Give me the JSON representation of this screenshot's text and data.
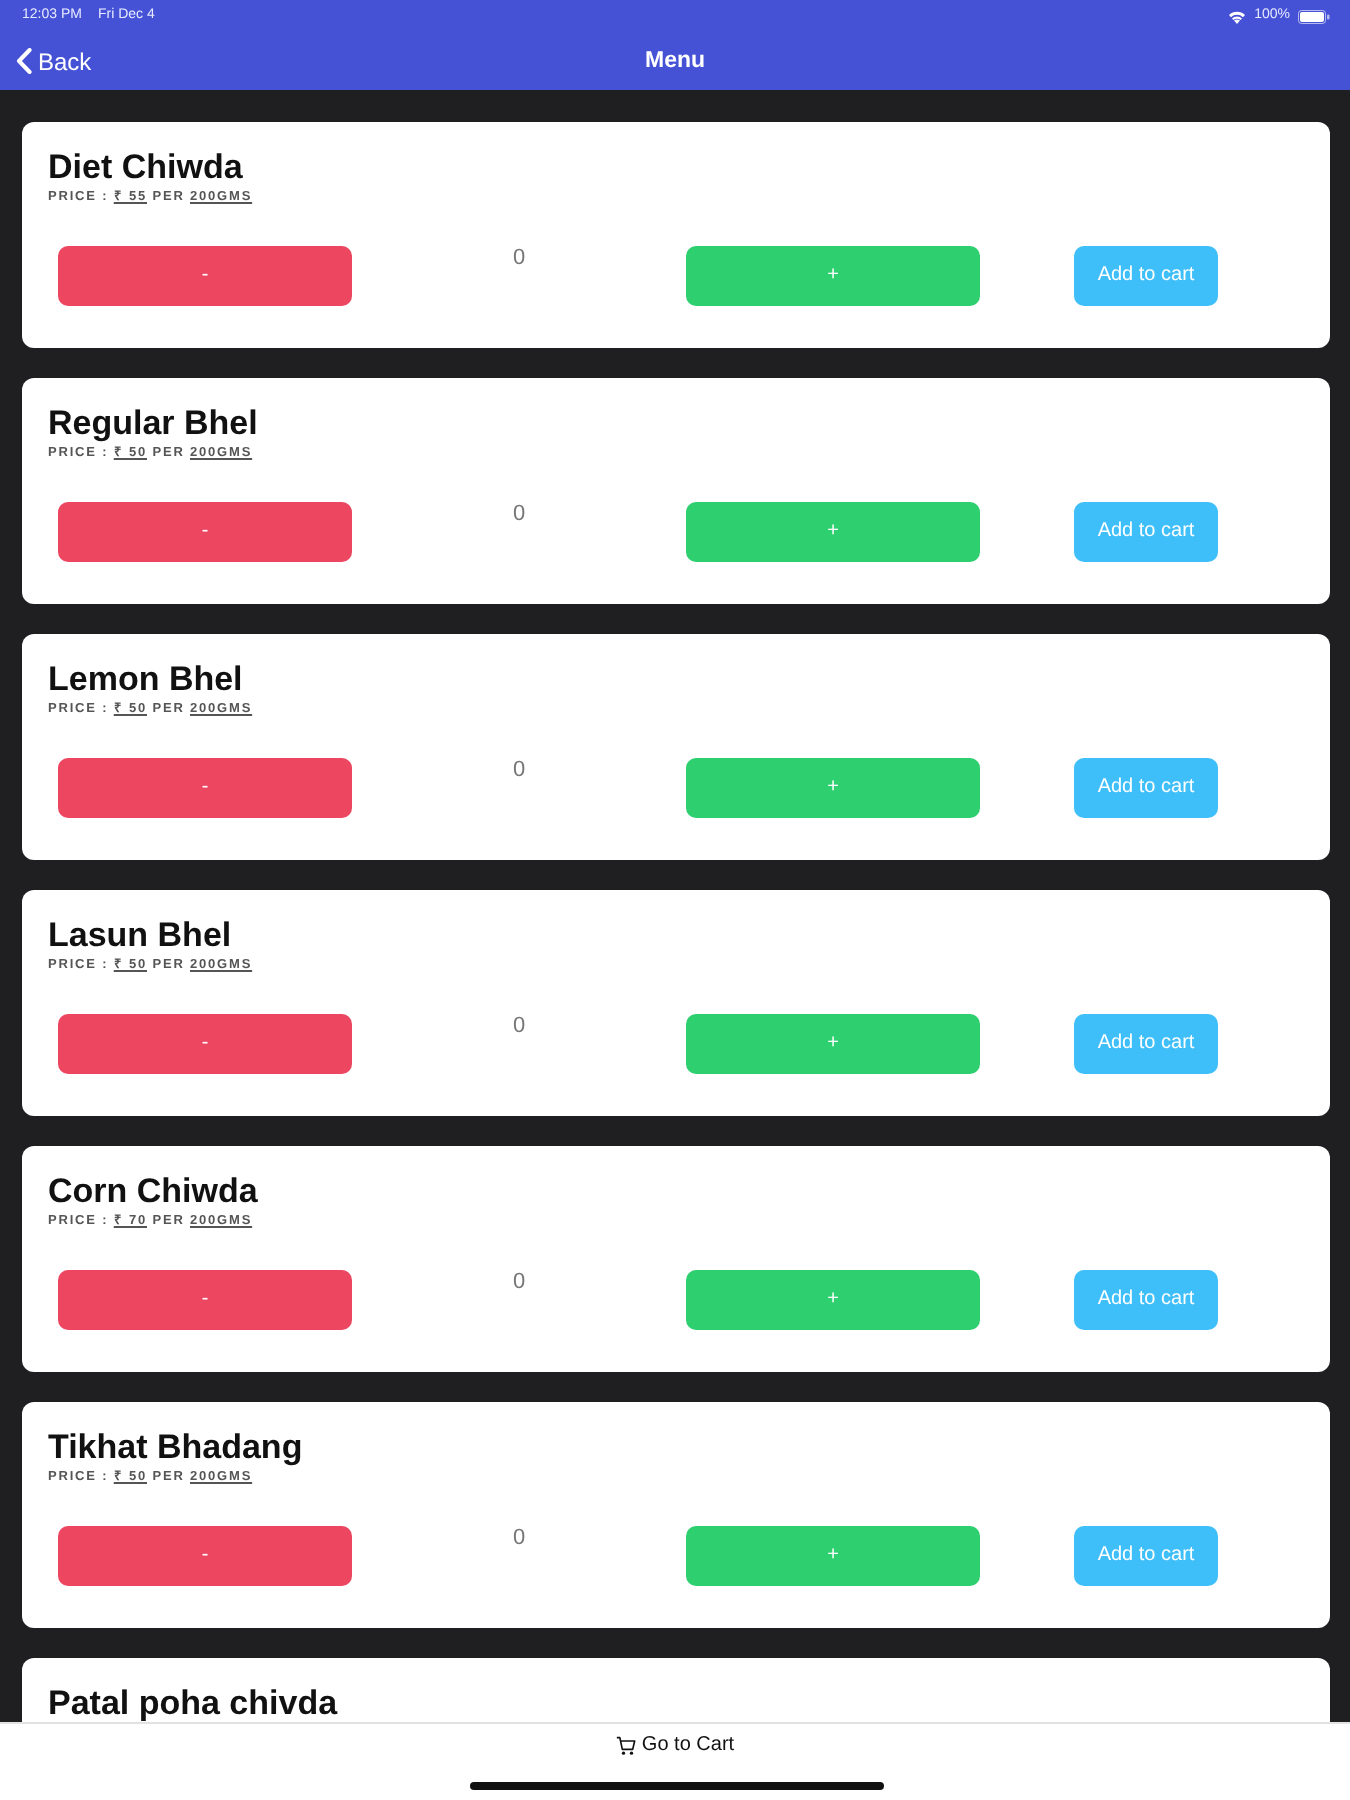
{
  "status_bar": {
    "time": "12:03 PM",
    "date": "Fri Dec 4",
    "battery": "100%"
  },
  "nav": {
    "back": "Back",
    "title": "Menu"
  },
  "items": [
    {
      "name": "Diet Chiwda",
      "price_label": "PRICE :",
      "price": "₹ 55",
      "per": "PER",
      "unit": "200GMS",
      "minus": "-",
      "quantity": "0",
      "plus": "+",
      "add": "Add to cart"
    },
    {
      "name": "Regular Bhel",
      "price_label": "PRICE :",
      "price": "₹ 50",
      "per": "PER",
      "unit": "200GMS",
      "minus": "-",
      "quantity": "0",
      "plus": "+",
      "add": "Add to cart"
    },
    {
      "name": "Lemon Bhel",
      "price_label": "PRICE :",
      "price": "₹ 50",
      "per": "PER",
      "unit": "200GMS",
      "minus": "-",
      "quantity": "0",
      "plus": "+",
      "add": "Add to cart"
    },
    {
      "name": "Lasun Bhel",
      "price_label": "PRICE :",
      "price": "₹ 50",
      "per": "PER",
      "unit": "200GMS",
      "minus": "-",
      "quantity": "0",
      "plus": "+",
      "add": "Add to cart"
    },
    {
      "name": "Corn Chiwda",
      "price_label": "PRICE :",
      "price": "₹ 70",
      "per": "PER",
      "unit": "200GMS",
      "minus": "-",
      "quantity": "0",
      "plus": "+",
      "add": "Add to cart"
    },
    {
      "name": "Tikhat Bhadang",
      "price_label": "PRICE :",
      "price": "₹ 50",
      "per": "PER",
      "unit": "200GMS",
      "minus": "-",
      "quantity": "0",
      "plus": "+",
      "add": "Add to cart"
    },
    {
      "name": "Patal poha chivda"
    }
  ],
  "footer": {
    "cart": "Go to Cart"
  }
}
